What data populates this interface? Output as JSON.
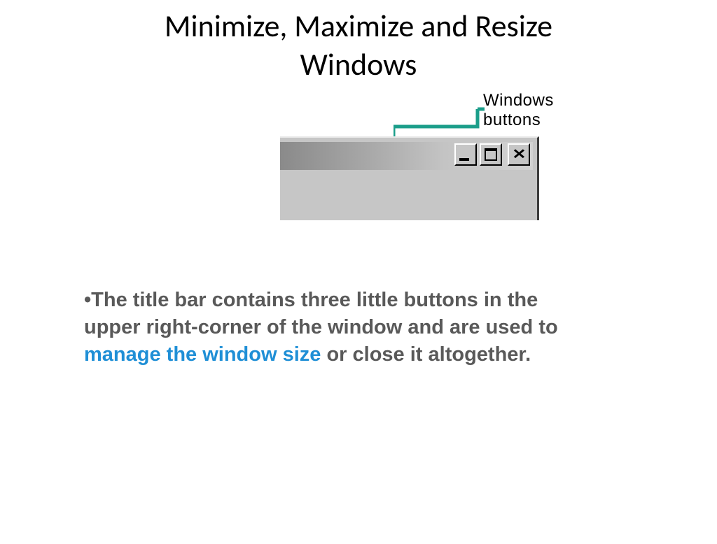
{
  "title_line1": "Minimize, Maximize and Resize",
  "title_line2": "Windows",
  "callout": "Windows buttons",
  "body": {
    "bullet": "•",
    "part1": "The title bar contains  three little buttons in the upper right-corner of the window and are used to ",
    "highlight": "manage the window size",
    "part2": " or close it altogether."
  },
  "colors": {
    "teal": "#1b9e8a",
    "highlight": "#1f8fd6",
    "body_text": "#595959"
  }
}
